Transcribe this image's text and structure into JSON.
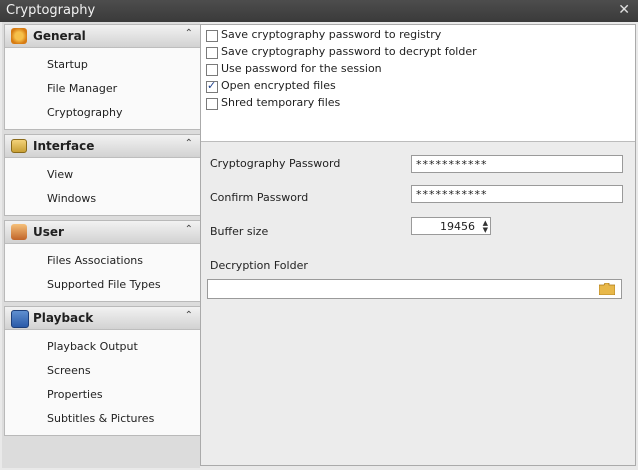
{
  "window": {
    "title": "Cryptography",
    "close_glyph": "✕"
  },
  "sidebar": {
    "groups": [
      {
        "label": "General",
        "icon": "gear-icon",
        "chevron": "⌃",
        "items": [
          {
            "label": "Startup"
          },
          {
            "label": "File Manager"
          },
          {
            "label": "Cryptography"
          }
        ]
      },
      {
        "label": "Interface",
        "icon": "monitor-icon",
        "chevron": "⌃",
        "items": [
          {
            "label": "View"
          },
          {
            "label": "Windows"
          }
        ]
      },
      {
        "label": "User",
        "icon": "user-icon",
        "chevron": "⌃",
        "items": [
          {
            "label": "Files Associations"
          },
          {
            "label": "Supported File Types"
          }
        ]
      },
      {
        "label": "Playback",
        "icon": "playback-icon",
        "chevron": "⌃",
        "items": [
          {
            "label": "Playback Output"
          },
          {
            "label": "Screens"
          },
          {
            "label": "Properties"
          },
          {
            "label": "Subtitles & Pictures"
          }
        ]
      }
    ]
  },
  "options": {
    "checkboxes": [
      {
        "label": "Save cryptography password to registry",
        "checked": false
      },
      {
        "label": "Save cryptography password to decrypt folder",
        "checked": false
      },
      {
        "label": "Use password for the session",
        "checked": false
      },
      {
        "label": "Open encrypted files",
        "checked": true
      },
      {
        "label": "Shred temporary files",
        "checked": false
      }
    ]
  },
  "form": {
    "password_label": "Cryptography Password",
    "password_value": "***********",
    "confirm_label": "Confirm Password",
    "confirm_value": "***********",
    "buffer_label": "Buffer size",
    "buffer_value": "19456",
    "folder_label": "Decryption Folder",
    "folder_value": ""
  },
  "colors": {
    "accent": "#1d3f8a",
    "titlebar": "#3f3f3f",
    "folder_icon": "#e8b84a"
  }
}
